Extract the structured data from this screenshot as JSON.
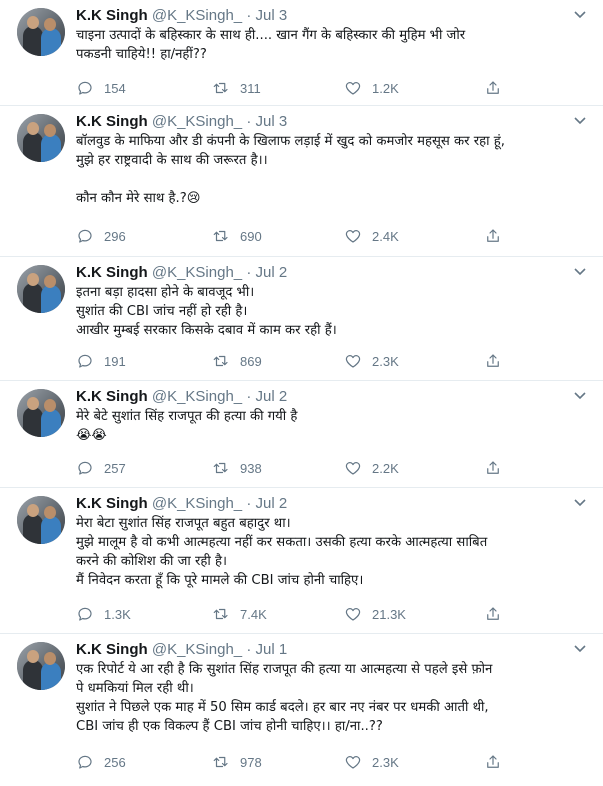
{
  "tweets": [
    {
      "name": "K.K Singh",
      "handle": "@K_KSingh_",
      "sep": "·",
      "date": "Jul 3",
      "text": "चाइना उत्पादों के बहिस्कार के साथ ही.... खान गैंग के बहिस्कार की मुहिम भी जोर\nपकडनी चाहिये!! हा/नहीं??",
      "replies": "154",
      "retweets": "311",
      "likes": "1.2K"
    },
    {
      "name": "K.K Singh",
      "handle": "@K_KSingh_",
      "sep": "·",
      "date": "Jul 3",
      "text": "बॉलवुड के माफिया और डी कंपनी के खिलाफ लड़ाई में खुद को कमजोर महसूस कर रहा हूं,\nमुझे हर राष्ट्रवादी के साथ की जरूरत है।।\n\nकौन कौन मेरे साथ है.?😢",
      "replies": "296",
      "retweets": "690",
      "likes": "2.4K"
    },
    {
      "name": "K.K Singh",
      "handle": "@K_KSingh_",
      "sep": "·",
      "date": "Jul 2",
      "text": "इतना बड़ा हादसा होने के बावजूद भी।\nसुशांत की CBI जांच नहीं हो रही है।\nआखीर मुम्बई सरकार किसके दबाव में काम कर रही हैं।",
      "replies": "191",
      "retweets": "869",
      "likes": "2.3K"
    },
    {
      "name": "K.K Singh",
      "handle": "@K_KSingh_",
      "sep": "·",
      "date": "Jul 2",
      "text": "मेरे बेटे सुशांत सिंह राजपूत की हत्या की गयी है\n😭😭",
      "replies": "257",
      "retweets": "938",
      "likes": "2.2K"
    },
    {
      "name": "K.K Singh",
      "handle": "@K_KSingh_",
      "sep": "·",
      "date": "Jul 2",
      "text": "मेरा बेटा सुशांत सिंह राजपूत बहुत बहादुर था।\nमुझे मालूम है वो कभी आत्महत्या नहीं कर सकता। उसकी हत्या करके आत्महत्या साबित\nकरने की कोशिश की जा रही है।\nमैं निवेदन करता हूँ कि पूरे मामले की CBI जांच होनी चाहिए।",
      "replies": "1.3K",
      "retweets": "7.4K",
      "likes": "21.3K"
    },
    {
      "name": "K.K Singh",
      "handle": "@K_KSingh_",
      "sep": "·",
      "date": "Jul 1",
      "text": "एक रिपोर्ट ये आ रही है कि सुशांत सिंह राजपूत की हत्या या आत्महत्या से पहले इसे फ़ोन\nपे धमकियां मिल रही थी।\nसुशांत ने पिछले एक माह में 50 सिम कार्ड बदले। हर बार नए नंबर पर धमकी आती थी,\nCBI जांच ही एक विकल्प हैं CBI जांच होनी चाहिए।। हा/ना..??",
      "replies": "256",
      "retweets": "978",
      "likes": "2.3K"
    }
  ]
}
